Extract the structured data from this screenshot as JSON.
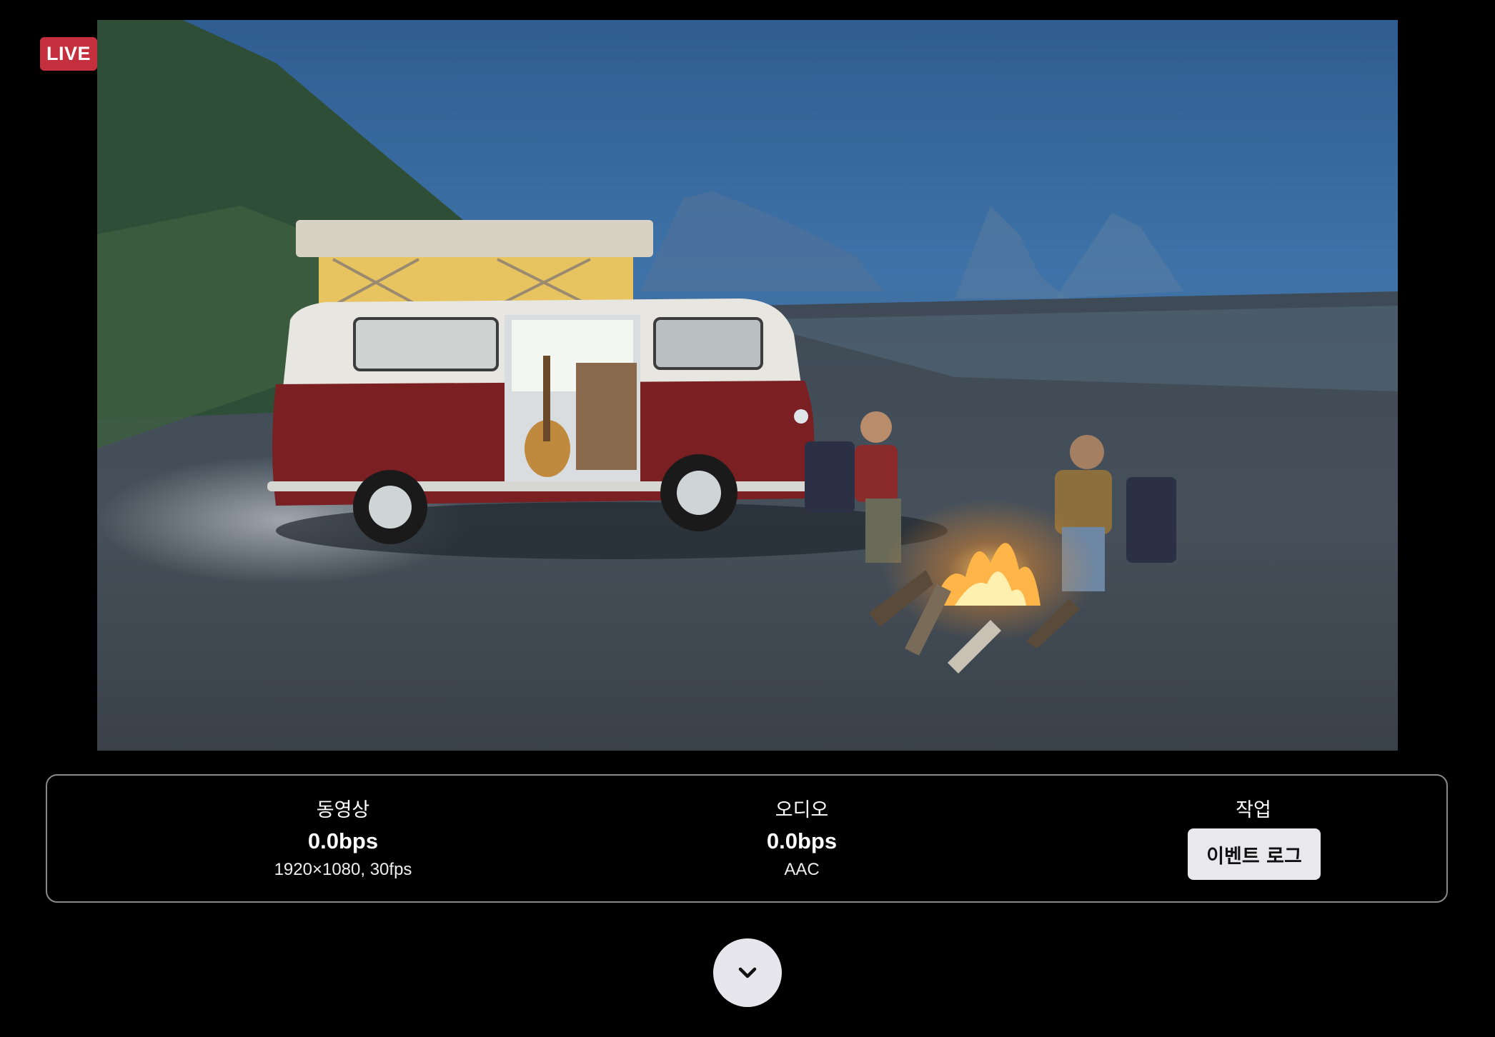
{
  "badge": {
    "label": "LIVE",
    "color": "#c5303e"
  },
  "video_panel": {
    "scene": "camper-van-beach-campfire-night",
    "stats": [
      {
        "title": "동영상",
        "rate": "0.0bps",
        "detail": "1920×1080, 30fps"
      },
      {
        "title": "오디오",
        "rate": "0.0bps",
        "detail": "AAC"
      }
    ],
    "actions": {
      "title": "작업",
      "event_log_label": "이벤트 로그"
    }
  },
  "expand_button": {
    "icon": "chevron-down-icon"
  }
}
